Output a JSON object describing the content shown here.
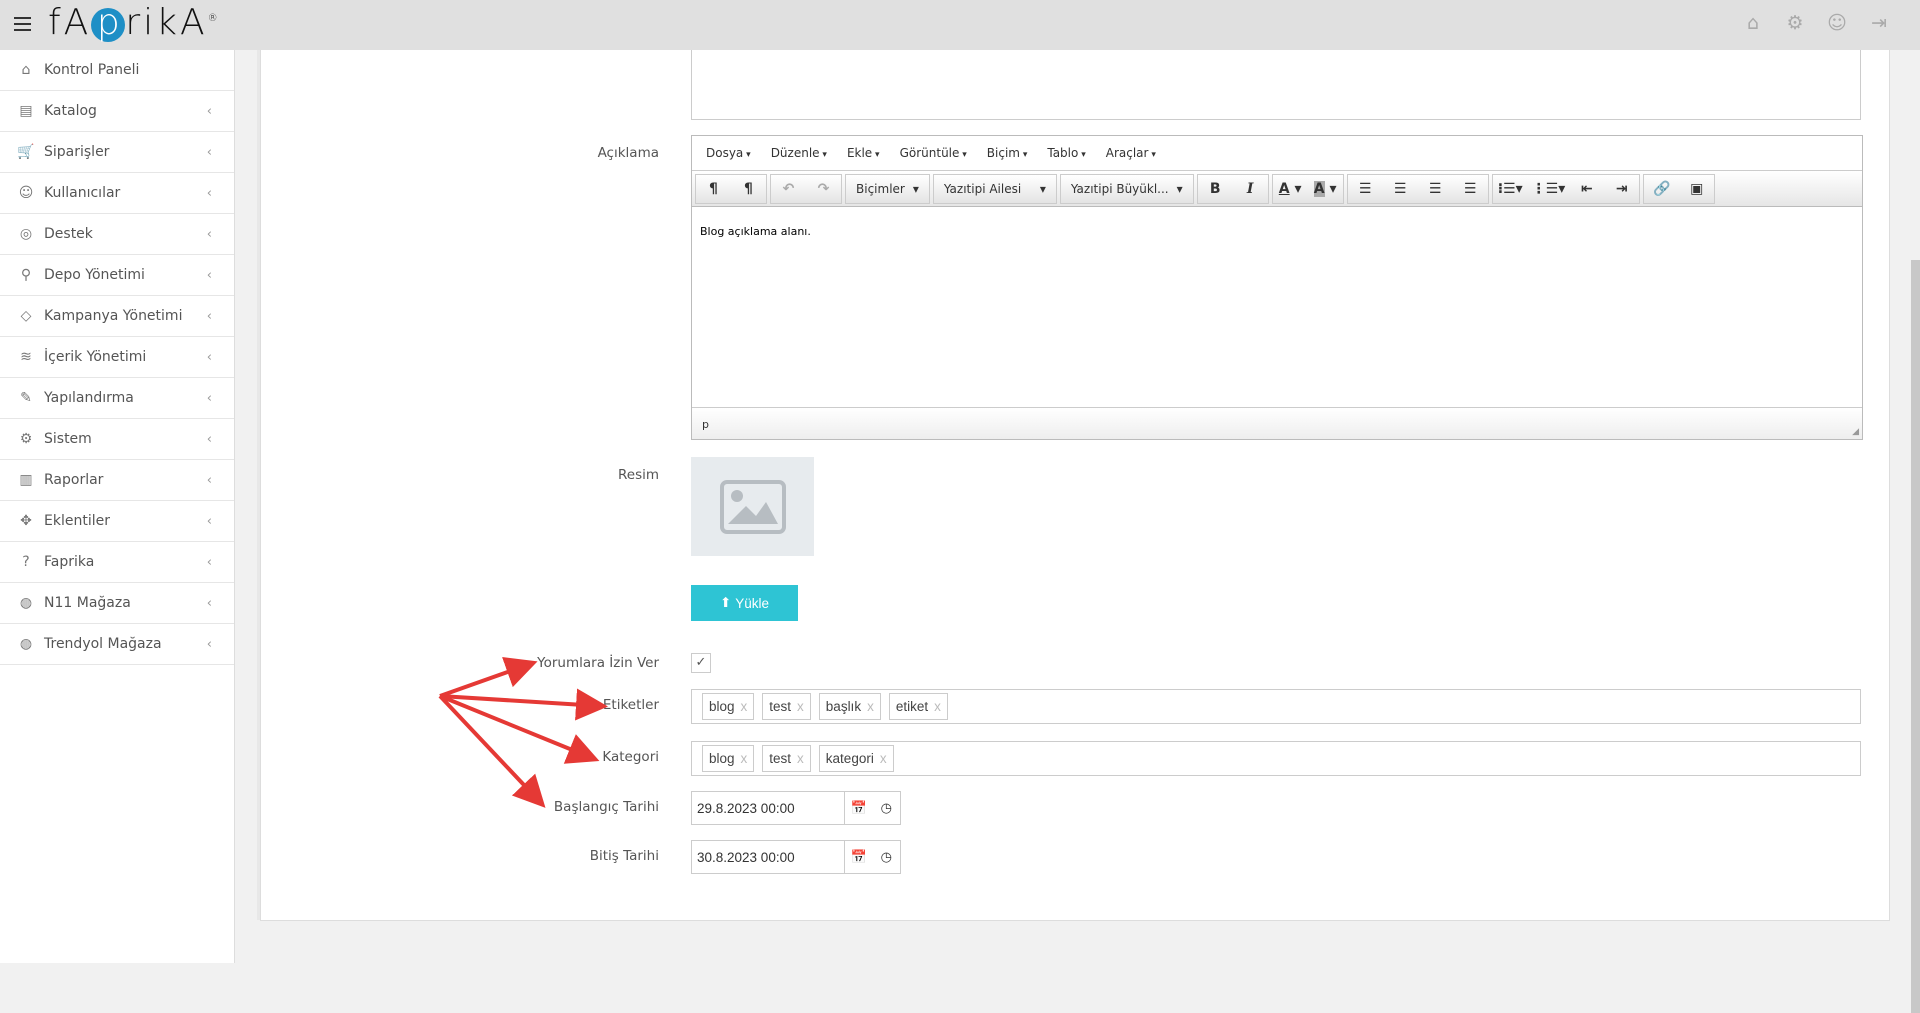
{
  "header": {
    "logo": "fApriKA",
    "icons": [
      "home-icon",
      "gear-icon",
      "user-icon",
      "logout-icon"
    ]
  },
  "sidebar": {
    "items": [
      {
        "label": "Kontrol Paneli",
        "icon": "home-icon",
        "glyph": "⌂"
      },
      {
        "label": "Katalog",
        "icon": "book-icon",
        "glyph": "▤"
      },
      {
        "label": "Siparişler",
        "icon": "cart-icon",
        "glyph": "🛒"
      },
      {
        "label": "Kullanıcılar",
        "icon": "users-icon",
        "glyph": "☺"
      },
      {
        "label": "Destek",
        "icon": "lifebuoy-icon",
        "glyph": "◎"
      },
      {
        "label": "Depo Yönetimi",
        "icon": "map-pin-icon",
        "glyph": "⚲"
      },
      {
        "label": "Kampanya Yönetimi",
        "icon": "tag-icon",
        "glyph": "◇"
      },
      {
        "label": "İçerik Yönetimi",
        "icon": "layers-icon",
        "glyph": "≋"
      },
      {
        "label": "Yapılandırma",
        "icon": "wrench-icon",
        "glyph": "✎"
      },
      {
        "label": "Sistem",
        "icon": "gear-icon",
        "glyph": "⚙"
      },
      {
        "label": "Raporlar",
        "icon": "bar-chart-icon",
        "glyph": "▥"
      },
      {
        "label": "Eklentiler",
        "icon": "puzzle-icon",
        "glyph": "✥"
      },
      {
        "label": "Faprika",
        "icon": "question-icon",
        "glyph": "?"
      },
      {
        "label": "N11 Mağaza",
        "icon": "globe-icon",
        "glyph": "◍"
      },
      {
        "label": "Trendyol Mağaza",
        "icon": "globe-icon",
        "glyph": "◍"
      }
    ]
  },
  "form": {
    "aciklama_label": "Açıklama",
    "editor": {
      "menus": [
        "Dosya",
        "Düzenle",
        "Ekle",
        "Görüntüle",
        "Biçim",
        "Tablo",
        "Araçlar"
      ],
      "formats": "Biçimler",
      "font_family": "Yazıtipi Ailesi",
      "font_size": "Yazıtipi Büyükl...",
      "content": "Blog açıklama alanı.",
      "status_path": "p"
    },
    "resim_label": "Resim",
    "upload_label": "Yükle",
    "comments_label": "Yorumlara İzin Ver",
    "comments_checked": true,
    "tags_label": "Etiketler",
    "tags": [
      "blog",
      "test",
      "başlık",
      "etiket"
    ],
    "category_label": "Kategori",
    "categories": [
      "blog",
      "test",
      "kategori"
    ],
    "tag_remove": "x",
    "start_label": "Başlangıç Tarihi",
    "start_value": "29.8.2023 00:00",
    "end_label": "Bitiş Tarihi",
    "end_value": "30.8.2023 00:00"
  },
  "annotation_color": "#e53935"
}
